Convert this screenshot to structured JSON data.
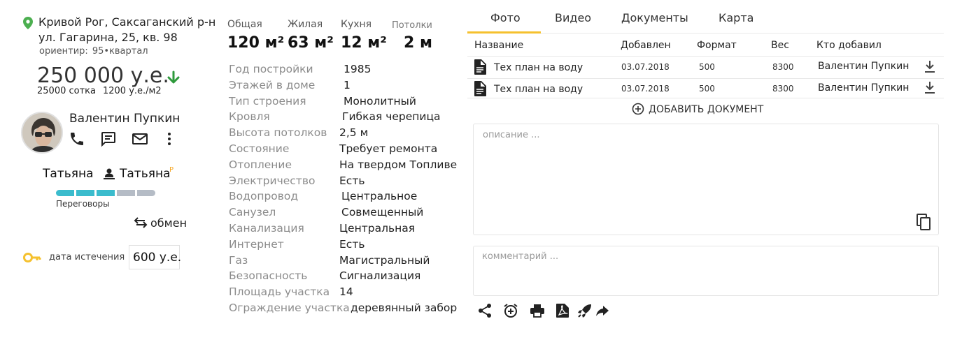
{
  "listing": {
    "address_line1": "Кривой Рог, Саксаганский р-н",
    "address_line2": "ул. Гагарина, 25, кв. 98",
    "landmark_label": "ориентир:",
    "landmark_value": "95•квартал",
    "price": "250 000 у.е.",
    "price_trend": "down",
    "price_per_sotka": "25000 сотка",
    "price_per_m2": "1200 у.е./м2"
  },
  "agent": {
    "name": "Валентин Пупкин",
    "actions": [
      "phone-icon",
      "sms-icon",
      "mail-icon",
      "more-vert-icon"
    ]
  },
  "deal": {
    "person1": "Татьяна",
    "person2": "Татьяна",
    "person2_badge": "P",
    "stage_total": 5,
    "stage_filled": 3,
    "stage_label": "Переговоры",
    "exchange_label": "обмен",
    "expiry_label": "дата истечения",
    "expiry_value": "600 у.е."
  },
  "stats": [
    {
      "label": "Общая",
      "value": "120 м²"
    },
    {
      "label": "Жилая",
      "value": "63 м²"
    },
    {
      "label": "Кухня",
      "value": "12 м²"
    },
    {
      "label": "Потолки",
      "value": "2 м"
    }
  ],
  "properties": [
    {
      "label": "Год постройки",
      "value": "1985"
    },
    {
      "label": "Этажей в доме",
      "value": "1"
    },
    {
      "label": "Тип строения",
      "value": "Монолитный"
    },
    {
      "label": "Кровля",
      "value": "Гибкая черепица"
    },
    {
      "label": "Высота потолков",
      "value": "2,5 м"
    },
    {
      "label": "Состояние",
      "value": "Требует ремонта"
    },
    {
      "label": "Отопление",
      "value": "На твердом Топливе"
    },
    {
      "label": "Электричество",
      "value": "Есть"
    },
    {
      "label": "Водопровод",
      "value": "Центральное"
    },
    {
      "label": "Санузел",
      "value": "Совмещенный"
    },
    {
      "label": "Канализация",
      "value": "Центральная"
    },
    {
      "label": "Интернет",
      "value": "Есть"
    },
    {
      "label": "Газ",
      "value": "Магистральный"
    },
    {
      "label": "Безопасность",
      "value": "Сигнализация"
    },
    {
      "label": "Площадь участка",
      "value": "14"
    },
    {
      "label": "Ограждение участка",
      "value": "деревянный забор"
    }
  ],
  "tabs": [
    "Фото",
    "Видео",
    "Документы",
    "Карта"
  ],
  "active_tab": "Фото",
  "documents": {
    "columns": [
      "Название",
      "Добавлен",
      "Формат",
      "Вес",
      "Кто добавил"
    ],
    "rows": [
      {
        "name": "Тех план на воду",
        "added": "03.07.2018",
        "format": "500",
        "size": "8300",
        "author": "Валентин Пупкин"
      },
      {
        "name": "Тех план на воду",
        "added": "03.07.2018",
        "format": "500",
        "size": "8300",
        "author": "Валентин Пупкин"
      }
    ],
    "add_label": "ДОБАВИТЬ ДОКУМЕНТ"
  },
  "notes": {
    "description_placeholder": "описание ...",
    "comment_placeholder": "комментарий ..."
  },
  "toolbar": [
    "share-icon",
    "alarm-add-icon",
    "print-icon",
    "pdf-icon",
    "rocket-icon",
    "forward-icon"
  ],
  "colors": {
    "accent": "#f5c12e",
    "progress_on": "#3bbccd",
    "progress_off": "#b5bcc6",
    "trend_down": "#2e9a3c",
    "pin": "#4caf50",
    "key": "#f5c12e"
  }
}
